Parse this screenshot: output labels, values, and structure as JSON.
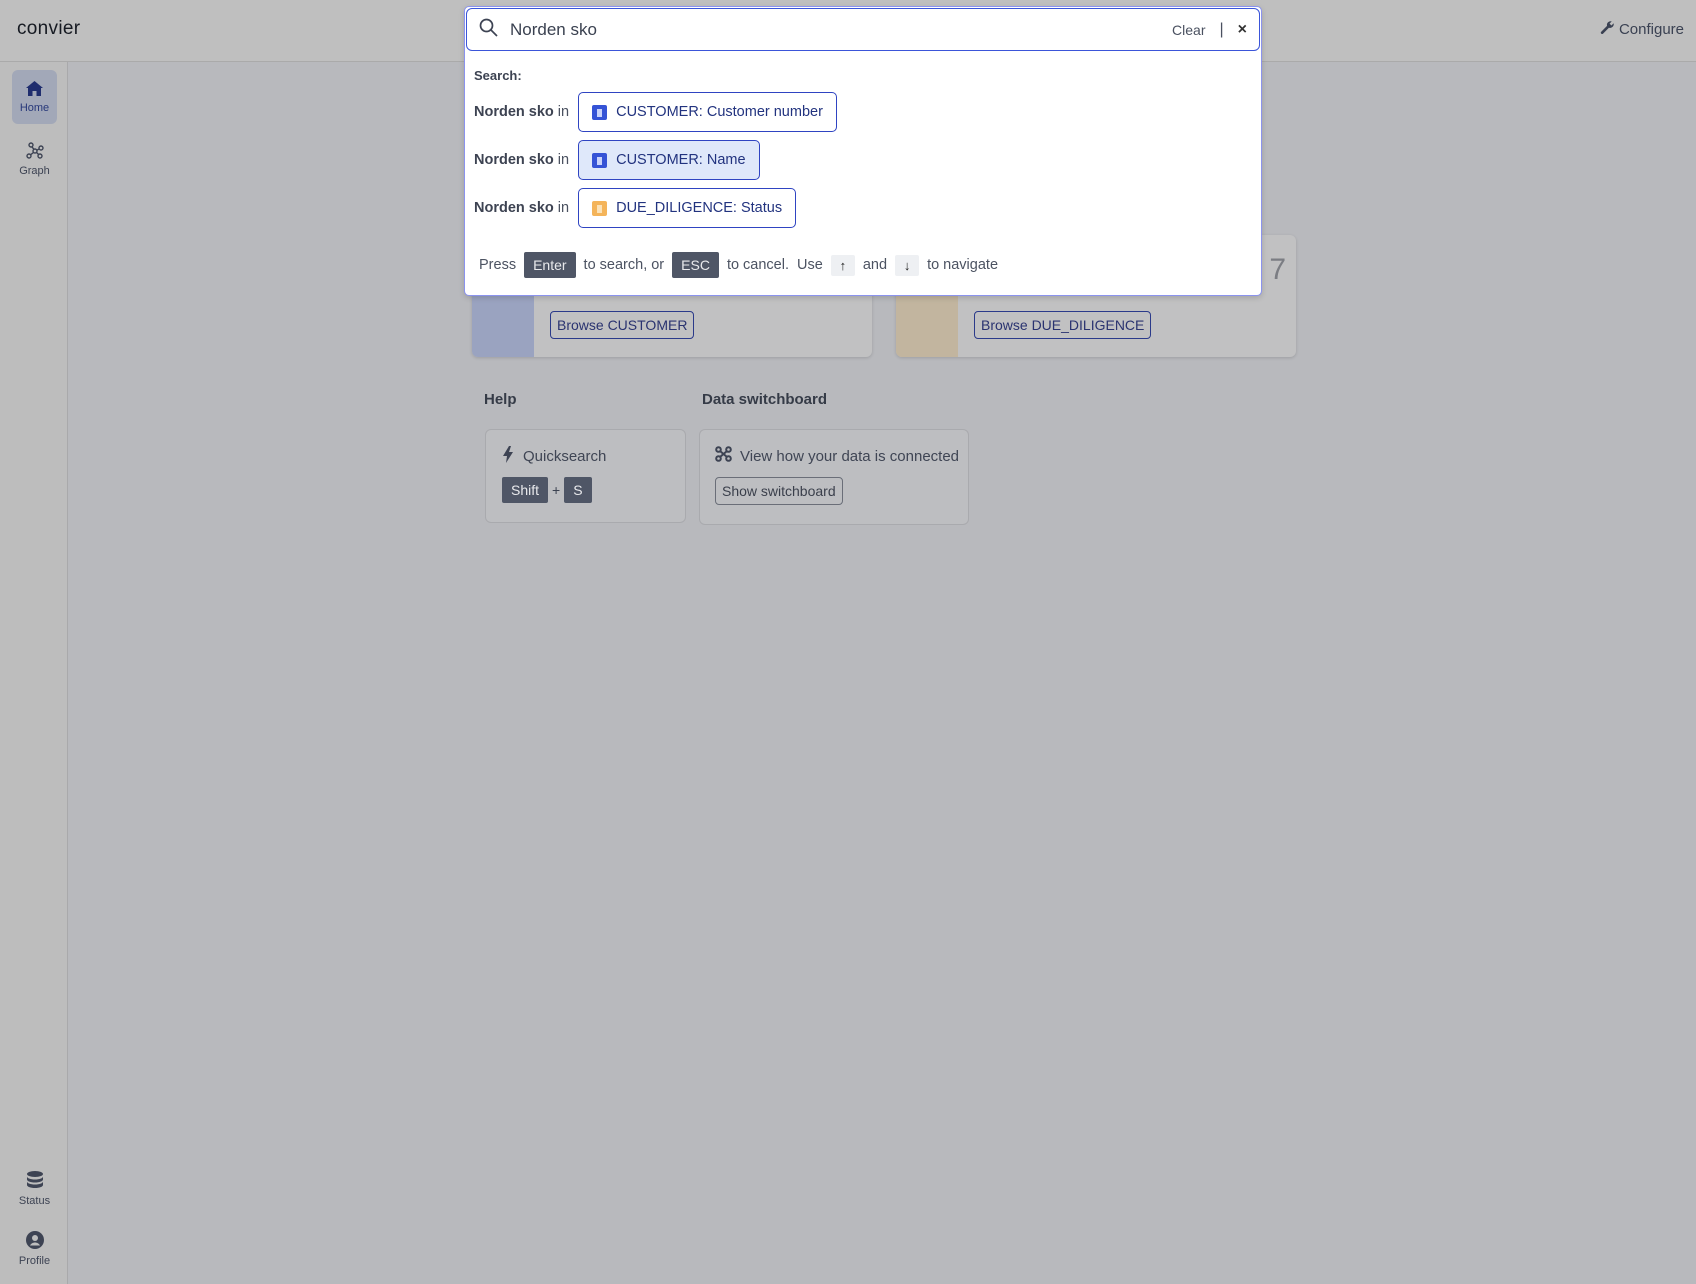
{
  "header": {
    "logo": "convier",
    "configure": "Configure"
  },
  "sidebar": {
    "items": [
      {
        "label": "Home",
        "icon": "home-icon",
        "active": true
      },
      {
        "label": "Graph",
        "icon": "graph-icon"
      },
      {
        "label": "Status",
        "icon": "database-icon"
      },
      {
        "label": "Profile",
        "icon": "user-circle-icon"
      }
    ]
  },
  "cards": [
    {
      "browse": "Browse CUSTOMER",
      "color": "#9aa3c0"
    },
    {
      "browse": "Browse DUE_DILIGENCE",
      "color": "#c2b59f",
      "count_partial": "7"
    }
  ],
  "help": {
    "title": "Help",
    "quicksearch": "Quicksearch",
    "keys": [
      "Shift",
      "S"
    ],
    "plus": "+"
  },
  "switchboard": {
    "title": "Data switchboard",
    "text": "View how your data is connected",
    "button": "Show switchboard"
  },
  "search": {
    "value": "Norden sko",
    "clear": "Clear",
    "separator": "|",
    "close": "×",
    "label": "Search:",
    "results": [
      {
        "term": "Norden sko",
        "in": "in",
        "target": "CUSTOMER: Customer number",
        "color": "#3553d6"
      },
      {
        "term": "Norden sko",
        "in": "in",
        "target": "CUSTOMER: Name",
        "color": "#3553d6",
        "selected": true
      },
      {
        "term": "Norden sko",
        "in": "in",
        "target": "DUE_DILIGENCE: Status",
        "color": "#f4b45a"
      }
    ],
    "hint": {
      "press": "Press",
      "enter": "Enter",
      "to_search": "to search, or",
      "esc": "ESC",
      "to_cancel": "to cancel.  Use",
      "up": "↑",
      "and": "and",
      "down": "↓",
      "to_navigate": "to navigate"
    }
  }
}
